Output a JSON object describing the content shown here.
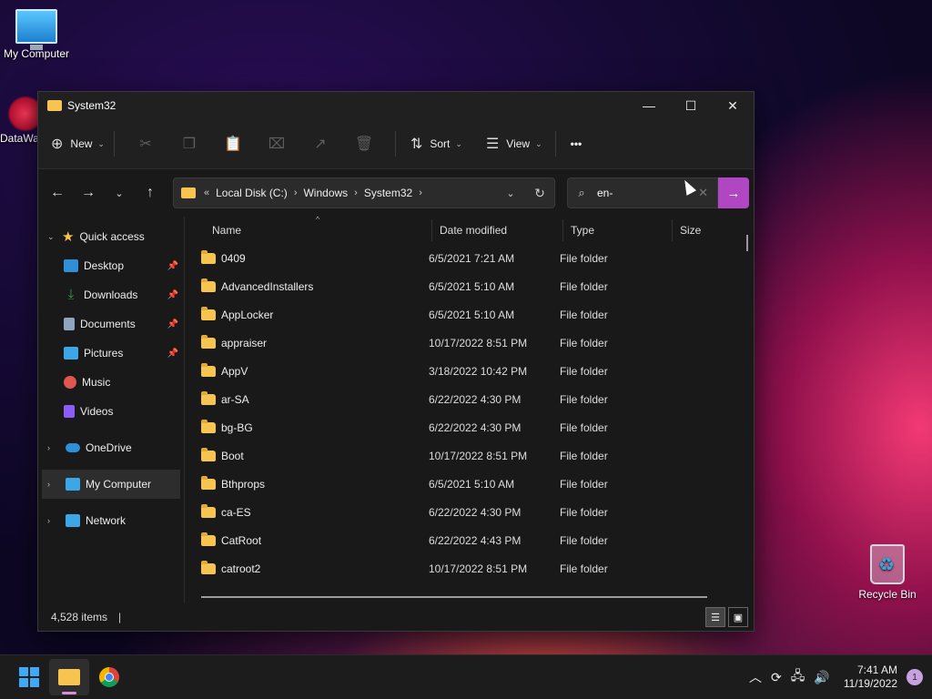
{
  "desktop": {
    "my_computer_label": "My Computer",
    "datawav_label": "DataWa",
    "recycle_bin_label": "Recycle Bin"
  },
  "window": {
    "title": "System32",
    "controls": {
      "minimize": "—",
      "maximize": "☐",
      "close": "✕"
    }
  },
  "toolbar": {
    "new_label": "New",
    "sort_label": "Sort",
    "view_label": "View",
    "more_label": "•••",
    "icons": [
      "cut-icon",
      "copy-icon",
      "paste-icon",
      "rename-icon",
      "share-icon",
      "delete-icon"
    ]
  },
  "address": {
    "overflow": "«",
    "crumbs": [
      "Local Disk (C:)",
      "Windows",
      "System32"
    ]
  },
  "search": {
    "value": "en-",
    "go": "→"
  },
  "sidebar": {
    "quick_access": "Quick access",
    "items": [
      {
        "label": "Desktop",
        "color": "#2f8fd8",
        "pinned": true
      },
      {
        "label": "Downloads",
        "color": "#2ea043",
        "pinned": true
      },
      {
        "label": "Documents",
        "color": "#8fa5bf",
        "pinned": true
      },
      {
        "label": "Pictures",
        "color": "#3ba7e6",
        "pinned": true
      },
      {
        "label": "Music",
        "color": "#e0574f",
        "pinned": false
      },
      {
        "label": "Videos",
        "color": "#8b5cf6",
        "pinned": false
      }
    ],
    "onedrive": "OneDrive",
    "my_computer": "My Computer",
    "network": "Network"
  },
  "columns": {
    "name": "Name",
    "date": "Date modified",
    "type": "Type",
    "size": "Size"
  },
  "files": [
    {
      "name": "0409",
      "date": "6/5/2021 7:21 AM",
      "type": "File folder"
    },
    {
      "name": "AdvancedInstallers",
      "date": "6/5/2021 5:10 AM",
      "type": "File folder"
    },
    {
      "name": "AppLocker",
      "date": "6/5/2021 5:10 AM",
      "type": "File folder"
    },
    {
      "name": "appraiser",
      "date": "10/17/2022 8:51 PM",
      "type": "File folder"
    },
    {
      "name": "AppV",
      "date": "3/18/2022 10:42 PM",
      "type": "File folder"
    },
    {
      "name": "ar-SA",
      "date": "6/22/2022 4:30 PM",
      "type": "File folder"
    },
    {
      "name": "bg-BG",
      "date": "6/22/2022 4:30 PM",
      "type": "File folder"
    },
    {
      "name": "Boot",
      "date": "10/17/2022 8:51 PM",
      "type": "File folder"
    },
    {
      "name": "Bthprops",
      "date": "6/5/2021 5:10 AM",
      "type": "File folder"
    },
    {
      "name": "ca-ES",
      "date": "6/22/2022 4:30 PM",
      "type": "File folder"
    },
    {
      "name": "CatRoot",
      "date": "6/22/2022 4:43 PM",
      "type": "File folder"
    },
    {
      "name": "catroot2",
      "date": "10/17/2022 8:51 PM",
      "type": "File folder"
    }
  ],
  "status": {
    "count": "4,528 items",
    "separator": "|"
  },
  "taskbar": {
    "time": "7:41 AM",
    "date": "11/19/2022",
    "notifications": "1"
  }
}
